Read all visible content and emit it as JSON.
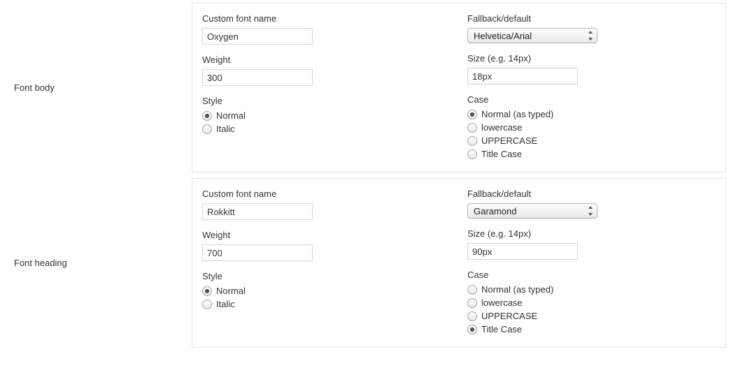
{
  "sections": [
    {
      "id": "body",
      "label": "Font body",
      "fontName": {
        "label": "Custom font name",
        "value": "Oxygen"
      },
      "fallback": {
        "label": "Fallback/default",
        "value": "Helvetica/Arial"
      },
      "weight": {
        "label": "Weight",
        "value": "300"
      },
      "size": {
        "label": "Size (e.g. 14px)",
        "value": "18px"
      },
      "style": {
        "label": "Style",
        "options": [
          {
            "label": "Normal",
            "checked": true
          },
          {
            "label": "Italic",
            "checked": false
          }
        ]
      },
      "case": {
        "label": "Case",
        "options": [
          {
            "label": "Normal (as typed)",
            "checked": true
          },
          {
            "label": "lowercase",
            "checked": false
          },
          {
            "label": "UPPERCASE",
            "checked": false
          },
          {
            "label": "Title Case",
            "checked": false
          }
        ]
      }
    },
    {
      "id": "heading",
      "label": "Font heading",
      "fontName": {
        "label": "Custom font name",
        "value": "Rokkitt"
      },
      "fallback": {
        "label": "Fallback/default",
        "value": "Garamond"
      },
      "weight": {
        "label": "Weight",
        "value": "700"
      },
      "size": {
        "label": "Size (e.g. 14px)",
        "value": "90px"
      },
      "style": {
        "label": "Style",
        "options": [
          {
            "label": "Normal",
            "checked": true
          },
          {
            "label": "Italic",
            "checked": false
          }
        ]
      },
      "case": {
        "label": "Case",
        "options": [
          {
            "label": "Normal (as typed)",
            "checked": false
          },
          {
            "label": "lowercase",
            "checked": false
          },
          {
            "label": "UPPERCASE",
            "checked": false
          },
          {
            "label": "Title Case",
            "checked": true
          }
        ]
      }
    }
  ]
}
